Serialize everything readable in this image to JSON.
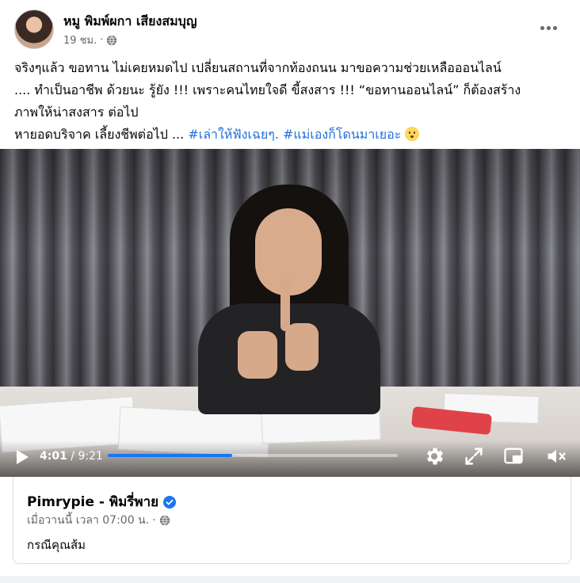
{
  "post": {
    "author": "หมู พิมพ์ผกา เสียงสมบุญ",
    "timestamp": "19 ชม.",
    "separator": "·",
    "privacy_icon": "globe-icon",
    "more_icon": "more-horizontal-icon",
    "caption": {
      "line1": "จริงๆแล้ว ขอทาน ไม่เคยหมดไป เปลี่ยนสถานที่จากท้องถนน มาขอความช่วยเหลือออนไลน์",
      "line2": ".... ทำเป็นอาชีพ ด้วยนะ รู้ยัง !!! เพราะคนไทยใจดี ขี้สงสาร !!!  “ขอทานออนไลน์” ก็ต้องสร้าง",
      "line3": "ภาพให้น่าสงสาร  ต่อไป",
      "line4_text": "หายอดบริจาค เลี้ยงชีพต่อไป ... ",
      "hashtag1": "#เล่าให้ฟังเฉยๆ.",
      "hashtag2": "#แม่เองก็โดนมาเยอะ",
      "emoji": "slightly-frowning-face-emoji"
    }
  },
  "video": {
    "current_time": "4:01",
    "time_separator": " / ",
    "duration": "9:21",
    "progress_fraction": 0.429,
    "buffered_fraction": 0.43,
    "accent_color": "#1877f2",
    "controls": [
      "play-icon",
      "settings-icon",
      "fullscreen-icon",
      "picture-in-picture-icon",
      "mute-icon"
    ]
  },
  "shared": {
    "page_name": "Pimrypie - พิมรี่พาย",
    "verified": true,
    "timestamp": "เมื่อวานนี้ เวลา 07:00 น.",
    "separator": "·",
    "text": "กรณีคุณส้ม"
  }
}
